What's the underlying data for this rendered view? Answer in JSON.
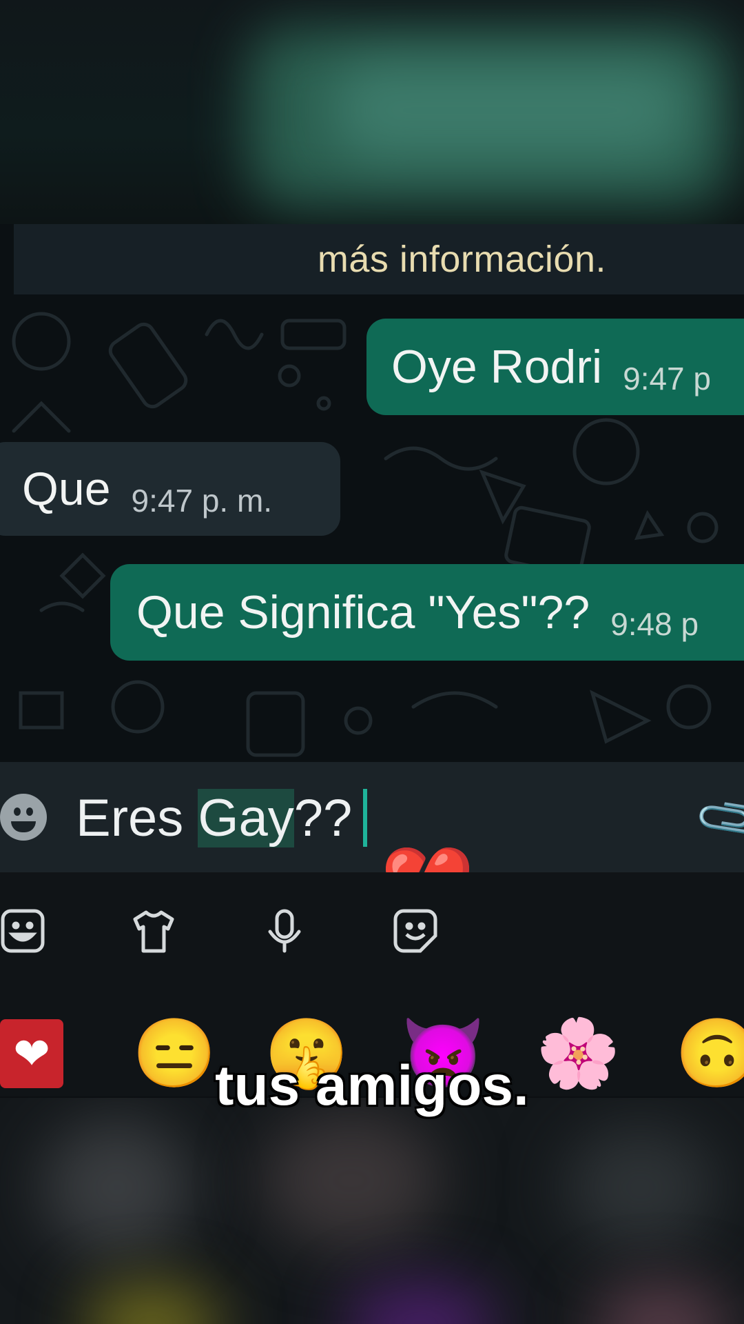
{
  "system_message": "más información.",
  "messages": [
    {
      "direction": "outgoing",
      "text": "Oye Rodri",
      "time": "9:47 p"
    },
    {
      "direction": "incoming",
      "text": "Que",
      "time": "9:47 p. m."
    },
    {
      "direction": "outgoing",
      "text": "Que Significa \"Yes\"??",
      "time": "9:48 p"
    }
  ],
  "compose": {
    "text_before": "Eres ",
    "text_highlighted": "Gay",
    "text_after": "??"
  },
  "reaction_emoji": "💔",
  "keyboard_toolbar": [
    "emoji-keyboard-icon",
    "tshirt-icon",
    "microphone-icon",
    "sticker-icon"
  ],
  "emoji_row": [
    "❤️",
    "😑",
    "🤫",
    "👿",
    "🌸",
    "🙃"
  ],
  "subtitle": "tus amigos.",
  "colors": {
    "outgoing_bubble": "#0f6a55",
    "incoming_bubble": "#1f2a30",
    "chat_background": "#0b1013",
    "caret": "#1fb39a",
    "system_text": "#e8dcb0"
  }
}
